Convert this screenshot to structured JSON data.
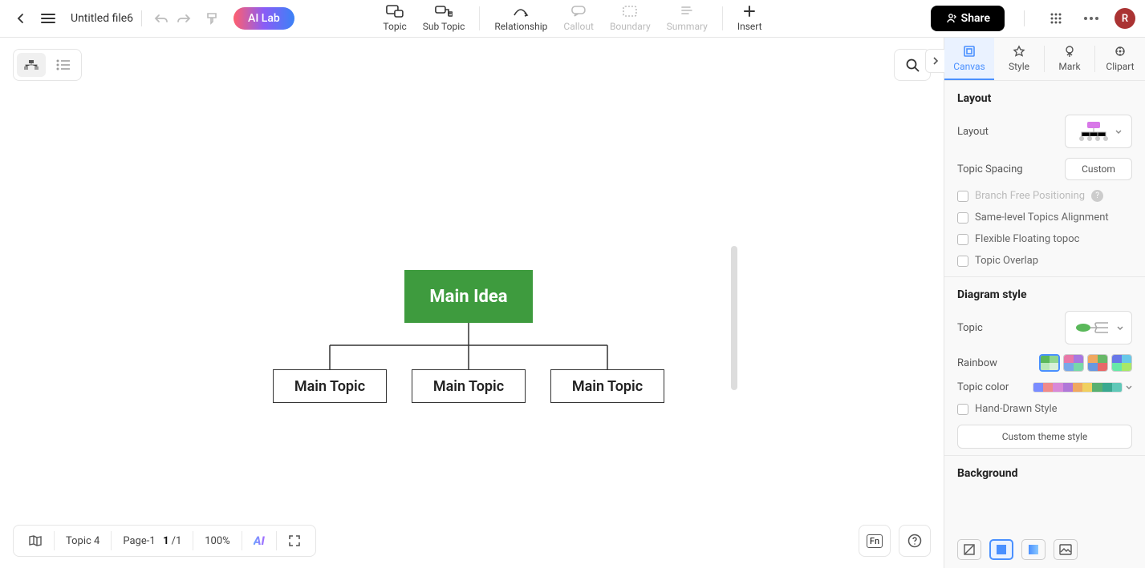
{
  "header": {
    "filename": "Untitled file6",
    "ai_lab": "AI Lab",
    "share": "Share",
    "avatar_letter": "R"
  },
  "toolbar": {
    "topic": "Topic",
    "subtopic": "Sub Topic",
    "relationship": "Relationship",
    "callout": "Callout",
    "boundary": "Boundary",
    "summary": "Summary",
    "insert": "Insert"
  },
  "mindmap": {
    "root": "Main Idea",
    "children": [
      "Main Topic",
      "Main Topic",
      "Main Topic"
    ]
  },
  "panel": {
    "tabs": {
      "canvas": "Canvas",
      "style": "Style",
      "mark": "Mark",
      "clipart": "Clipart"
    },
    "layout_section": "Layout",
    "layout_label": "Layout",
    "spacing_label": "Topic Spacing",
    "spacing_value": "Custom",
    "branch_free": "Branch Free Positioning",
    "same_level": "Same-level Topics Alignment",
    "flexible": "Flexible Floating topoc",
    "overlap": "Topic Overlap",
    "diagram_section": "Diagram style",
    "topic_label": "Topic",
    "rainbow_label": "Rainbow",
    "topiccolor_label": "Topic color",
    "handdrawn": "Hand-Drawn Style",
    "custom_theme": "Custom theme style",
    "background_section": "Background"
  },
  "bottombar": {
    "topic_count": "Topic 4",
    "page_label": "Page-1",
    "page_current": "1",
    "page_sep": "/",
    "page_total": "1",
    "zoom": "100%"
  },
  "colors": {
    "accent": "#4a90ff",
    "root_bg": "#3e9b3e",
    "strip": [
      "#7a8cff",
      "#f08a8a",
      "#d889d8",
      "#b078d8",
      "#f0a860",
      "#f0d060",
      "#58b070",
      "#3aa890",
      "#60c8b8"
    ]
  }
}
